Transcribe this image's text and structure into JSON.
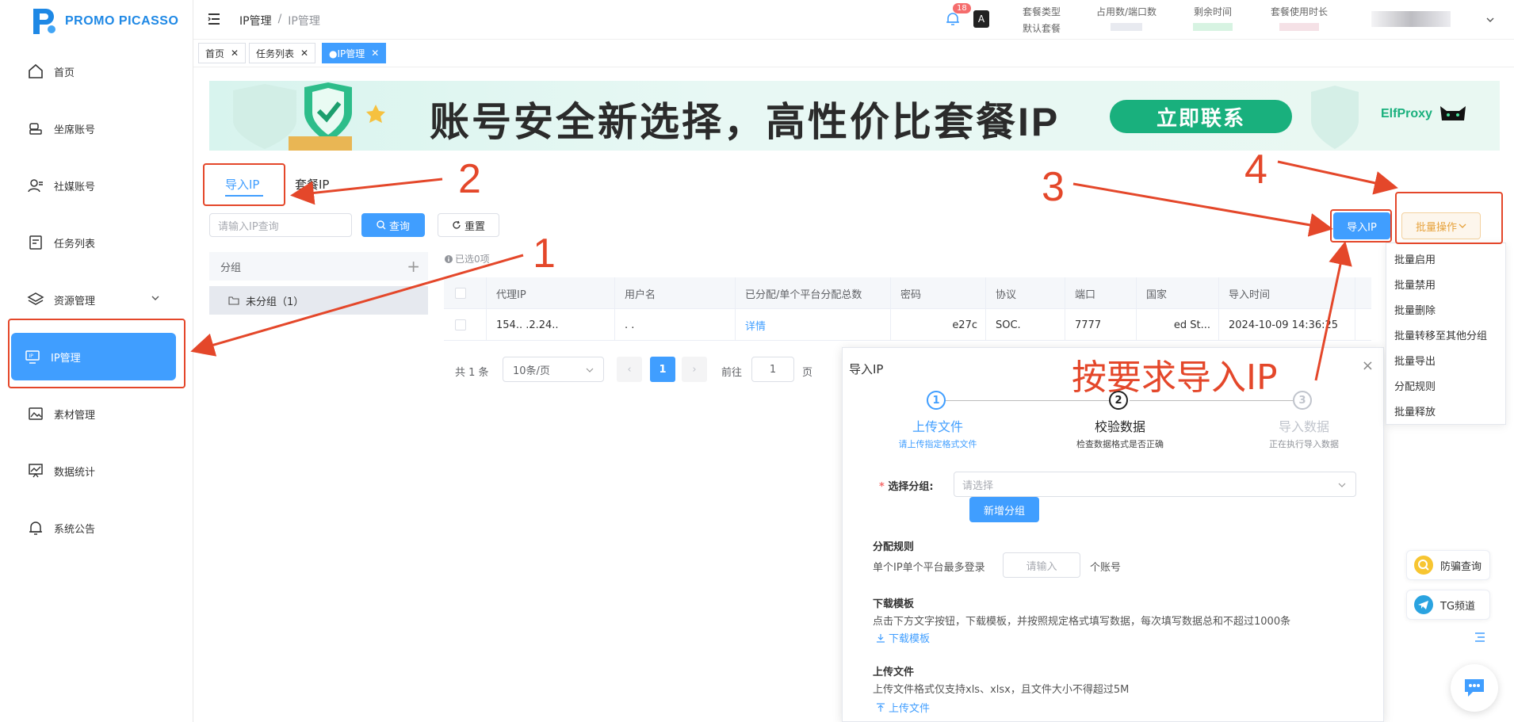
{
  "brand": {
    "name": "PROMO PICASSO"
  },
  "sidebar": {
    "items": [
      {
        "label": "首页",
        "icon": "home-icon"
      },
      {
        "label": "坐席账号",
        "icon": "seat-icon"
      },
      {
        "label": "社媒账号",
        "icon": "user-icon"
      },
      {
        "label": "任务列表",
        "icon": "tasks-icon"
      },
      {
        "label": "资源管理",
        "icon": "layers-icon"
      },
      {
        "label": "IP管理",
        "icon": "monitor-icon"
      },
      {
        "label": "素材管理",
        "icon": "image-icon"
      },
      {
        "label": "数据统计",
        "icon": "chart-icon"
      },
      {
        "label": "系统公告",
        "icon": "bell-icon"
      }
    ]
  },
  "header": {
    "breadcrumb": [
      "IP管理",
      "/",
      "IP管理"
    ],
    "notification_count": "18",
    "stats": [
      {
        "label": "套餐类型",
        "value": "默认套餐"
      },
      {
        "label": "占用数/端口数",
        "value": ""
      },
      {
        "label": "剩余时间",
        "value": ""
      },
      {
        "label": "套餐使用时长",
        "value": ""
      }
    ]
  },
  "tags": [
    {
      "label": "首页"
    },
    {
      "label": "任务列表"
    },
    {
      "label": "●IP管理"
    }
  ],
  "banner": {
    "headline": "账号安全新选择，高性价比套餐IP",
    "cta": "立即联系",
    "partner": "ElfProxy"
  },
  "tabs": [
    {
      "label": "导入IP",
      "active": true
    },
    {
      "label": "套餐IP",
      "active": false
    }
  ],
  "toolbar": {
    "search_placeholder": "请输入IP查询",
    "query_label": "查询",
    "reset_label": "重置",
    "import_label": "导入IP",
    "batch_label": "批量操作"
  },
  "groups": {
    "header": "分组",
    "items": [
      {
        "label": "未分组（1）"
      }
    ]
  },
  "selection": "已选0项",
  "table": {
    "columns": [
      "代理IP",
      "用户名",
      "已分配/单个平台分配总数",
      "密码",
      "协议",
      "端口",
      "国家",
      "导入时间"
    ],
    "rows": [
      [
        "154.. .2.24..",
        ". .",
        "详情",
        "e27c",
        "SOC.",
        "7777",
        "ed St...",
        "2024-10-09 14:36:25"
      ]
    ]
  },
  "pagination": {
    "total": "共 1 条",
    "page_size": "10条/页",
    "current": "1",
    "goto_label": "前往",
    "goto_value": "1",
    "page_suffix": "页"
  },
  "dialog": {
    "title": "导入IP",
    "steps": [
      {
        "num": "1",
        "title": "上传文件",
        "desc": "请上传指定格式文件"
      },
      {
        "num": "2",
        "title": "校验数据",
        "desc": "检查数据格式是否正确"
      },
      {
        "num": "3",
        "title": "导入数据",
        "desc": "正在执行导入数据"
      }
    ],
    "group_label": "选择分组:",
    "group_placeholder": "请选择",
    "new_group": "新增分组",
    "rule_title": "分配规则",
    "rule_prefix": "单个IP单个平台最多登录",
    "rule_placeholder": "请输入",
    "rule_suffix": "个账号",
    "template_title": "下载模板",
    "template_desc": "点击下方文字按钮，下载模板，并按照规定格式填写数据，每次填写数据总和不超过1000条",
    "template_link": "下载模板",
    "upload_title": "上传文件",
    "upload_desc": "上传文件格式仅支持xls、xlsx，且文件大小不得超过5M",
    "upload_link": "上传文件"
  },
  "dropdown": {
    "items": [
      "批量启用",
      "批量禁用",
      "批量删除",
      "批量转移至其他分组",
      "批量导出",
      "分配规则",
      "批量释放"
    ]
  },
  "floats": {
    "anti_query": "防骗查询",
    "tg_channel": "TG频道"
  },
  "annotations": {
    "n1": "1",
    "n2": "2",
    "n3": "3",
    "n4": "4",
    "instruction": "按要求导入IP"
  },
  "colors": {
    "primary": "#409eff",
    "annotation": "#e4472a",
    "banner_cta": "#19b07d",
    "batch_button": "#e6a23c"
  }
}
